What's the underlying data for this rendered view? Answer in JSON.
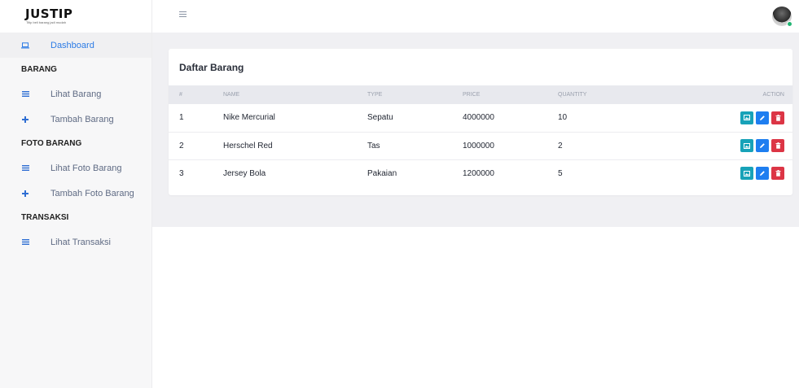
{
  "brand": {
    "title": "JUSTIP",
    "tagline": "Titip beli barang jadi mudah"
  },
  "sidebar": {
    "dashboard": "Dashboard",
    "sections": [
      {
        "header": "BARANG",
        "items": [
          {
            "label": "Lihat Barang",
            "icon": "list-icon"
          },
          {
            "label": "Tambah Barang",
            "icon": "plus-icon"
          }
        ]
      },
      {
        "header": "FOTO BARANG",
        "items": [
          {
            "label": "Lihat Foto Barang",
            "icon": "list-icon"
          },
          {
            "label": "Tambah Foto Barang",
            "icon": "plus-icon"
          }
        ]
      },
      {
        "header": "TRANSAKSI",
        "items": [
          {
            "label": "Lihat Transaksi",
            "icon": "list-icon"
          }
        ]
      }
    ]
  },
  "colors": {
    "accent": "#2c7be5",
    "info": "#17a2b8",
    "primary": "#1e7ef0",
    "danger": "#dc3545",
    "online": "#22b573"
  },
  "card": {
    "title": "Daftar Barang",
    "columns": {
      "no": "#",
      "name": "NAME",
      "type": "TYPE",
      "price": "PRICE",
      "quantity": "QUANTITY",
      "action": "ACTION"
    },
    "rows": [
      {
        "no": "1",
        "name": "Nike Mercurial",
        "type": "Sepatu",
        "price": "4000000",
        "quantity": "10"
      },
      {
        "no": "2",
        "name": "Herschel Red",
        "type": "Tas",
        "price": "1000000",
        "quantity": "2"
      },
      {
        "no": "3",
        "name": "Jersey Bola",
        "type": "Pakaian",
        "price": "1200000",
        "quantity": "5"
      }
    ]
  }
}
